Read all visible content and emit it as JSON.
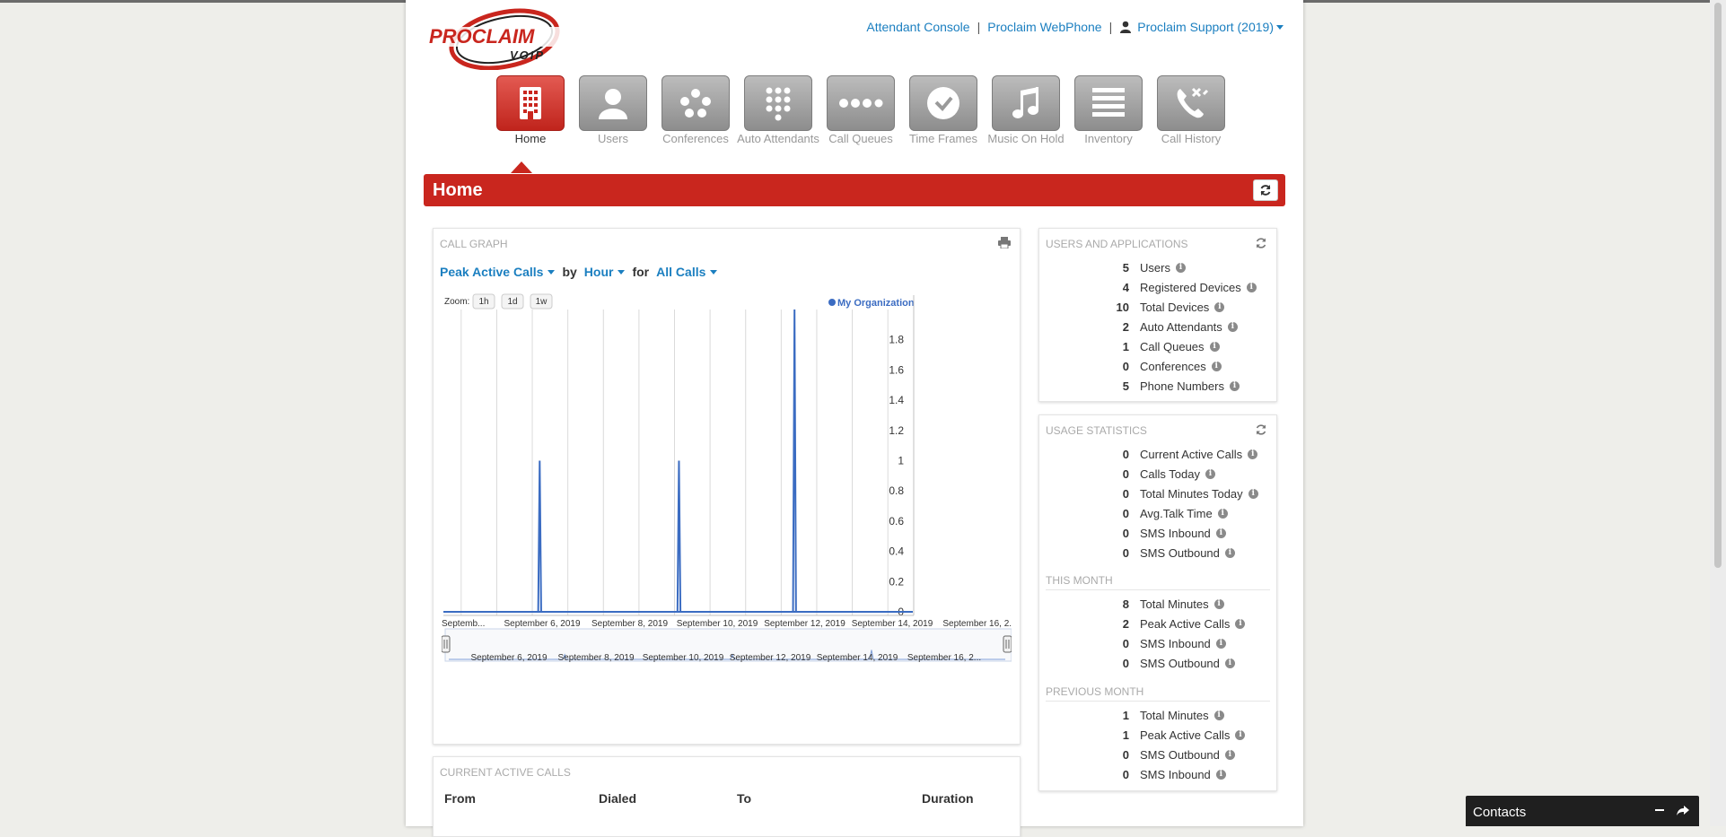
{
  "header": {
    "links": [
      "Attendant Console",
      "Proclaim WebPhone"
    ],
    "user": "Proclaim Support (2019)"
  },
  "logo": {
    "text_top": "PROCLAIM",
    "text_bottom": "VOIP",
    "brand_color": "#c9261e"
  },
  "nav": {
    "items": [
      {
        "label": "Home",
        "icon": "building-icon",
        "active": true
      },
      {
        "label": "Users",
        "icon": "user-icon",
        "active": false
      },
      {
        "label": "Conferences",
        "icon": "conference-icon",
        "active": false
      },
      {
        "label": "Auto Attendants",
        "icon": "keypad-icon",
        "active": false
      },
      {
        "label": "Call Queues",
        "icon": "dots-icon",
        "active": false
      },
      {
        "label": "Time Frames",
        "icon": "clock-icon",
        "active": false
      },
      {
        "label": "Music On Hold",
        "icon": "music-icon",
        "active": false
      },
      {
        "label": "Inventory",
        "icon": "list-icon",
        "active": false
      },
      {
        "label": "Call History",
        "icon": "phone-history-icon",
        "active": false
      }
    ]
  },
  "page": {
    "title": "Home"
  },
  "graph": {
    "title": "CALL GRAPH",
    "metric": "Peak Active Calls",
    "by_text": "by",
    "interval": "Hour",
    "for_text": "for",
    "scope": "All Calls",
    "zoom_label": "Zoom:",
    "zoom_options": [
      "1h",
      "1d",
      "1w"
    ]
  },
  "chart_data": {
    "type": "line",
    "legend": "My Organization",
    "legend_position": "top-right",
    "series_color": "#3b6cc2",
    "x_range": [
      "2019-09-04",
      "2019-09-17"
    ],
    "x_tick_labels": [
      "Septemb...",
      "September 6, 2019",
      "September 8, 2019",
      "September 10, 2019",
      "September 12, 2019",
      "September 14, 2019",
      "September 16, 2..."
    ],
    "navigator_tick_labels": [
      "September 6, 2019",
      "September 8, 2019",
      "September 10, 2019",
      "September 12, 2019",
      "September 14, 2019",
      "September 16, 2..."
    ],
    "y_ticks": [
      0,
      0.2,
      0.4,
      0.6,
      0.8,
      1,
      1.2,
      1.4,
      1.6,
      1.8
    ],
    "ylim": [
      0,
      2
    ],
    "grid": true,
    "points": [
      {
        "x": "2019-09-04T00:00",
        "y": 0
      },
      {
        "x": "2019-09-06T16:00",
        "y": 0
      },
      {
        "x": "2019-09-06T17:00",
        "y": 1
      },
      {
        "x": "2019-09-06T18:00",
        "y": 0
      },
      {
        "x": "2019-09-10T14:00",
        "y": 0
      },
      {
        "x": "2019-09-10T15:00",
        "y": 1
      },
      {
        "x": "2019-09-10T16:00",
        "y": 0
      },
      {
        "x": "2019-09-13T20:00",
        "y": 0
      },
      {
        "x": "2019-09-13T21:00",
        "y": 2
      },
      {
        "x": "2019-09-13T22:00",
        "y": 0
      },
      {
        "x": "2019-09-17T00:00",
        "y": 0
      }
    ]
  },
  "users_apps": {
    "title": "USERS AND APPLICATIONS",
    "rows": [
      {
        "value": "5",
        "label": "Users"
      },
      {
        "value": "4",
        "label": "Registered Devices"
      },
      {
        "value": "10",
        "label": "Total Devices"
      },
      {
        "value": "2",
        "label": "Auto Attendants"
      },
      {
        "value": "1",
        "label": "Call Queues"
      },
      {
        "value": "0",
        "label": "Conferences"
      },
      {
        "value": "5",
        "label": "Phone Numbers"
      }
    ]
  },
  "usage": {
    "title": "USAGE STATISTICS",
    "rows": [
      {
        "value": "0",
        "label": "Current Active Calls"
      },
      {
        "value": "0",
        "label": "Calls Today"
      },
      {
        "value": "0",
        "label": "Total Minutes Today"
      },
      {
        "value": "0",
        "label": "Avg.Talk Time"
      },
      {
        "value": "0",
        "label": "SMS Inbound"
      },
      {
        "value": "0",
        "label": "SMS Outbound"
      }
    ],
    "this_month_title": "THIS MONTH",
    "this_month": [
      {
        "value": "8",
        "label": "Total Minutes"
      },
      {
        "value": "2",
        "label": "Peak Active Calls"
      },
      {
        "value": "0",
        "label": "SMS Inbound"
      },
      {
        "value": "0",
        "label": "SMS Outbound"
      }
    ],
    "prev_month_title": "PREVIOUS MONTH",
    "prev_month": [
      {
        "value": "1",
        "label": "Total Minutes"
      },
      {
        "value": "1",
        "label": "Peak Active Calls"
      },
      {
        "value": "0",
        "label": "SMS Outbound"
      },
      {
        "value": "0",
        "label": "SMS Inbound"
      }
    ]
  },
  "active_calls": {
    "title": "CURRENT ACTIVE CALLS",
    "columns": [
      "From",
      "Dialed",
      "To",
      "Duration"
    ]
  },
  "contacts": {
    "label": "Contacts"
  }
}
